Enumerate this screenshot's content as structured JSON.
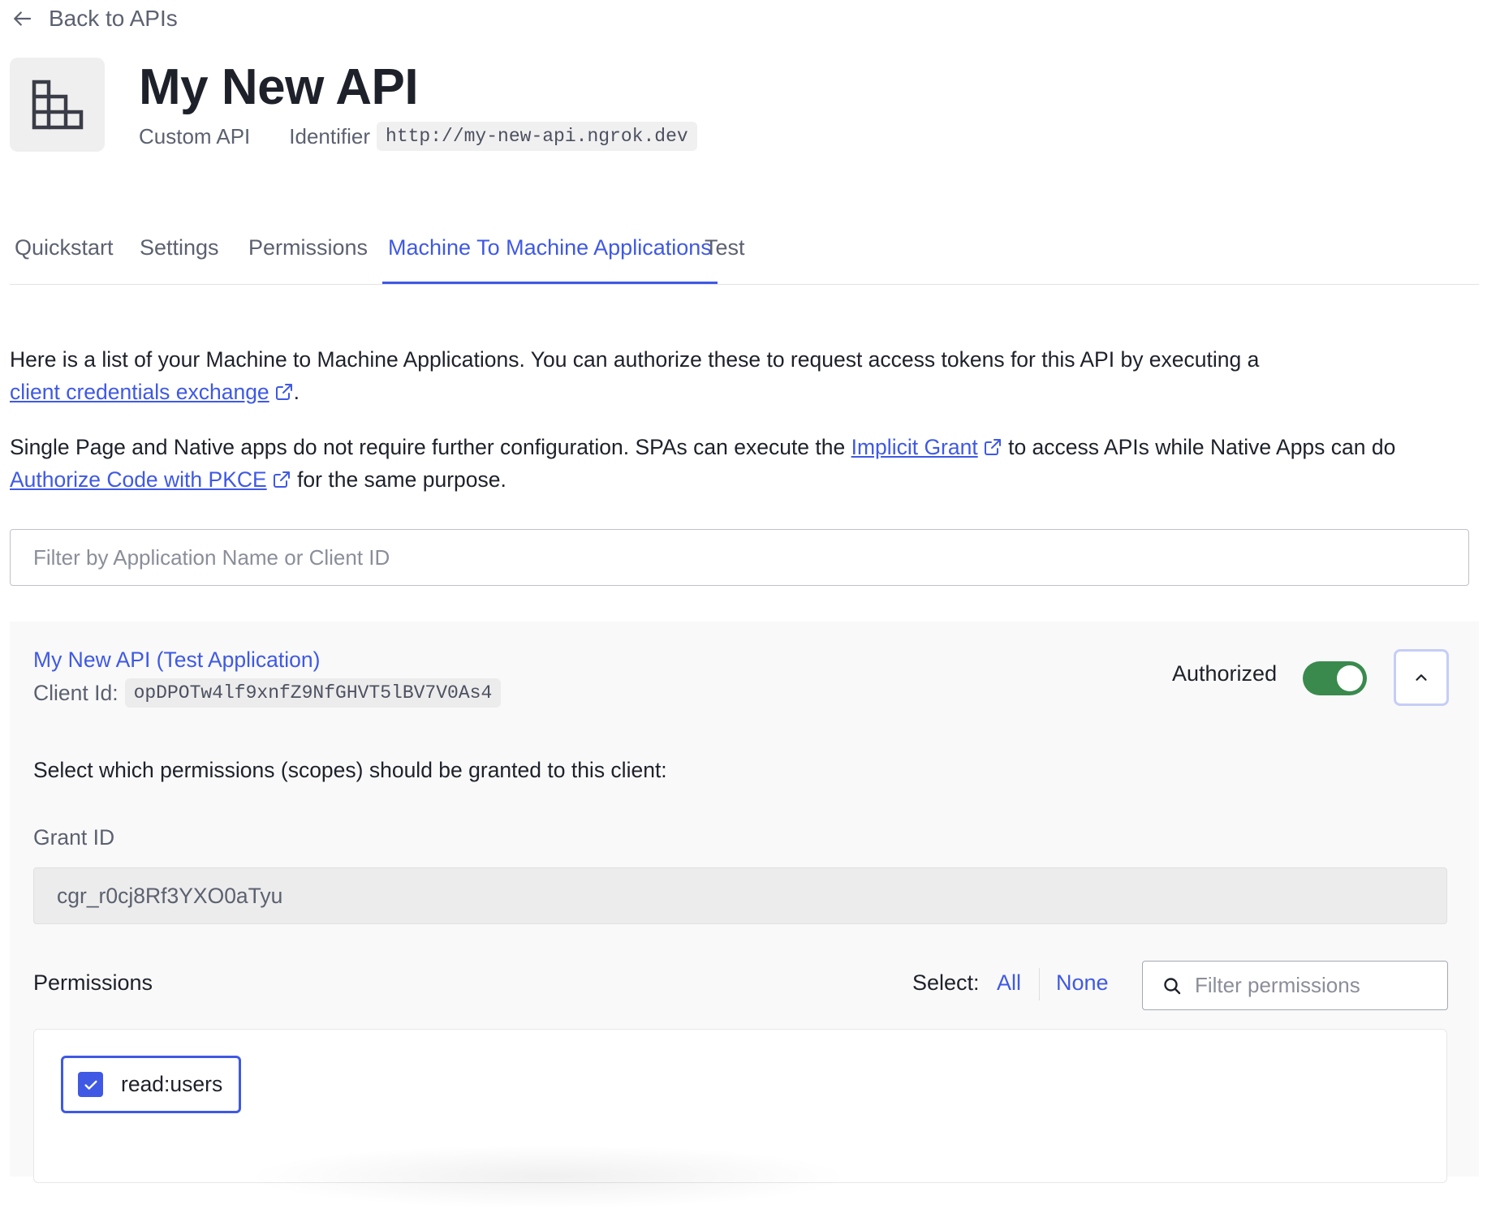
{
  "back_link": {
    "label": "Back to APIs",
    "icon": "arrow-left-icon"
  },
  "api": {
    "icon": "building-icon",
    "title": "My New API",
    "type": "Custom API",
    "identifier_label": "Identifier",
    "identifier": "http://my-new-api.ngrok.dev"
  },
  "tabs": [
    {
      "label": "Quickstart",
      "active": false
    },
    {
      "label": "Settings",
      "active": false
    },
    {
      "label": "Permissions",
      "active": false
    },
    {
      "label": "Machine To Machine Applications",
      "active": true
    },
    {
      "label": "Test",
      "active": false
    }
  ],
  "intro": {
    "p1_text": "Here is a list of your Machine to Machine Applications. You can authorize these to request access tokens for this API by executing a",
    "p1_link": "client credentials exchange",
    "p1_end": ".",
    "p2_text_before": "Single Page and Native apps do not require further configuration. SPAs can execute the",
    "p2_link1": "Implicit Grant",
    "p2_text_middle": "to access APIs while Native Apps can do",
    "p2_link2": "Authorize Code with PKCE",
    "p2_text_end": "for the same purpose."
  },
  "filter": {
    "placeholder": "Filter by Application Name or Client ID",
    "value": ""
  },
  "application": {
    "name": "My New API (Test Application)",
    "client_id_label": "Client Id:",
    "client_id": "opDPOTw4lf9xnfZ9NfGHVT5lBV7V0As4",
    "authorized_label": "Authorized",
    "authorized": true,
    "toggle_color": "#3a8a4e",
    "scopes_instruction": "Select which permissions (scopes) should be granted to this client:",
    "grant_id_label": "Grant ID",
    "grant_id": "cgr_r0cj8Rf3YXO0aTyu",
    "permissions_title": "Permissions",
    "select_label": "Select:",
    "select_all": "All",
    "select_none": "None",
    "permission_filter_placeholder": "Filter permissions",
    "permissions": [
      {
        "name": "read:users",
        "checked": true
      }
    ]
  },
  "colors": {
    "accent": "#3f59e4",
    "text": "#1e212a",
    "muted": "#5c6170"
  }
}
